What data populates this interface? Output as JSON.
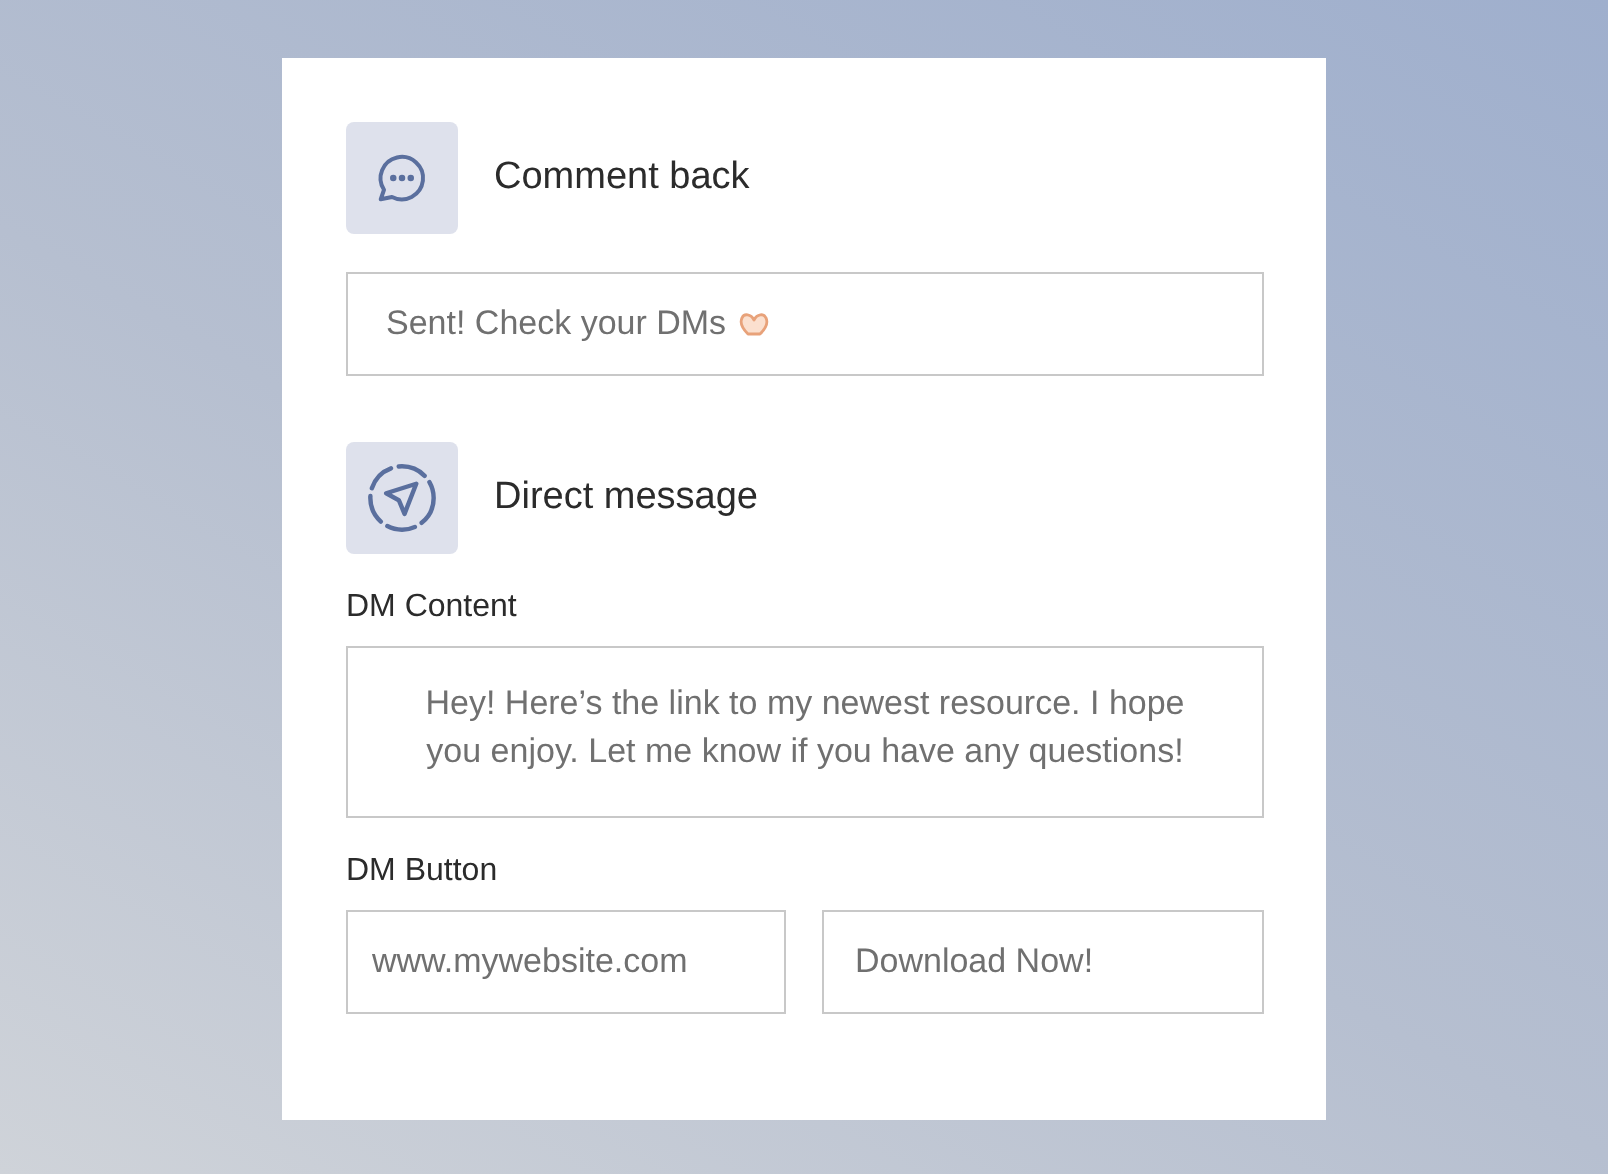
{
  "sections": [
    {
      "kind": "comment",
      "title": "Comment back",
      "field": {
        "value": "Sent! Check your DMs"
      }
    },
    {
      "kind": "direct",
      "title": "Direct message",
      "content": {
        "label": "DM Content",
        "value": "Hey! Here’s the link to my newest resource. I hope you enjoy. Let me know if you have any questions!"
      },
      "button": {
        "label": "DM Button",
        "url": "www.mywebsite.com",
        "text": "Download Now!"
      }
    }
  ]
}
